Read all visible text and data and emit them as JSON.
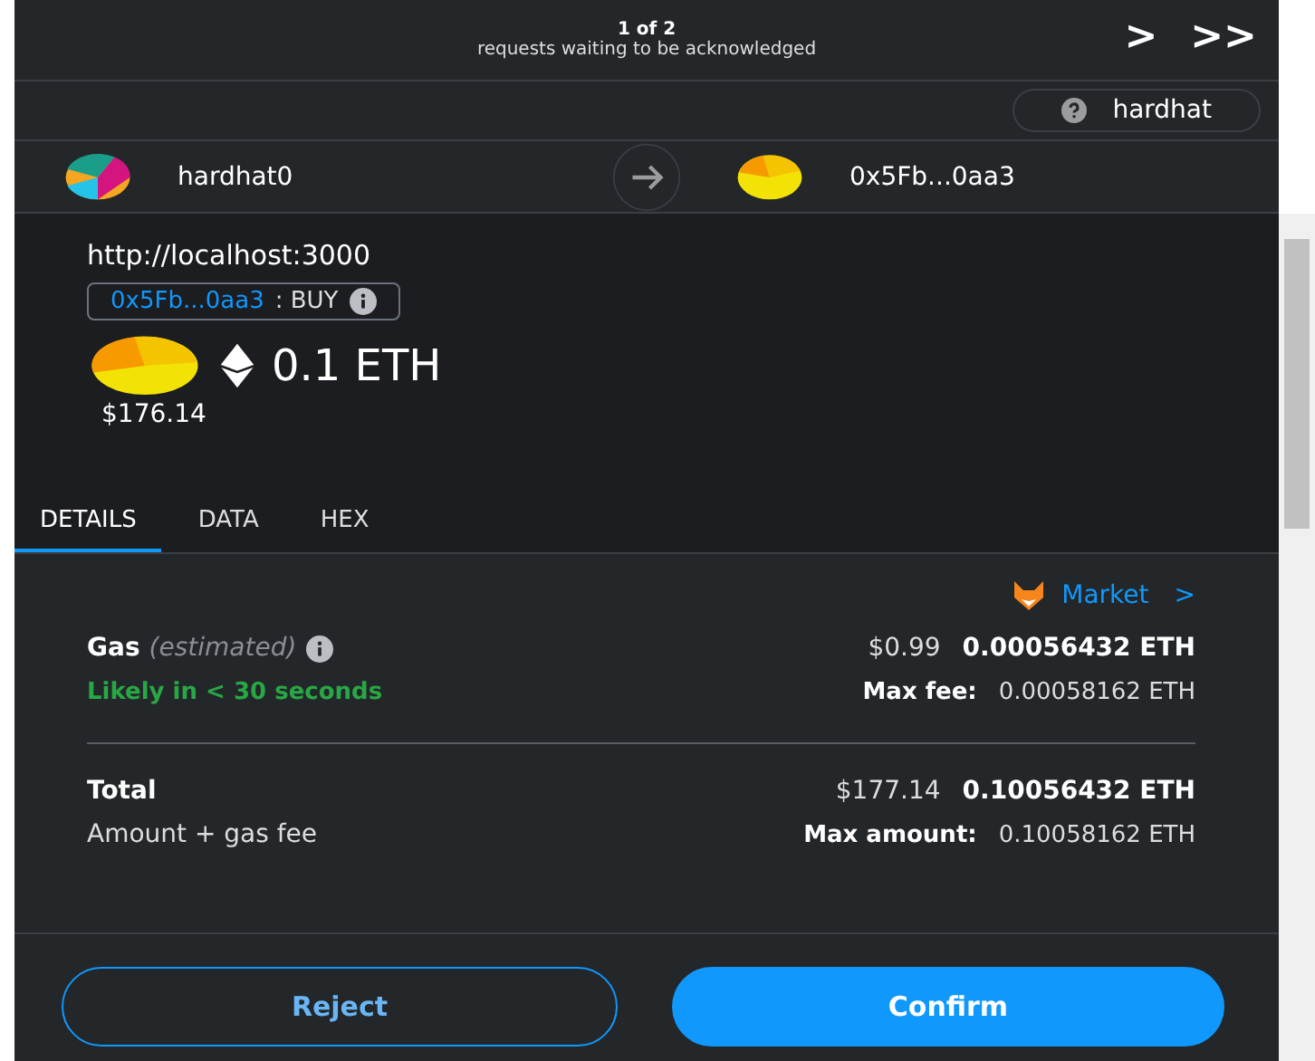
{
  "queue": {
    "counter": "1 of 2",
    "message": "requests waiting to be acknowledged",
    "next": ">",
    "last": ">>"
  },
  "network": {
    "label": "hardhat"
  },
  "from": {
    "name": "hardhat0"
  },
  "to": {
    "name": "0x5Fb...0aa3"
  },
  "summary": {
    "origin": "http://localhost:3000",
    "contract": "0x5Fb...0aa3",
    "method": ": BUY",
    "amount": "0.1 ETH",
    "fiat": "$176.14"
  },
  "tabs": [
    {
      "label": "DETAILS",
      "selected": true
    },
    {
      "label": "DATA",
      "selected": false
    },
    {
      "label": "HEX",
      "selected": false
    }
  ],
  "market": {
    "label": "Market",
    "chevron": ">"
  },
  "gas": {
    "label": "Gas",
    "note": "(estimated)",
    "fiat": "$0.99",
    "eth": "0.00056432 ETH",
    "speed": "Likely in < 30 seconds",
    "max_label": "Max fee:",
    "max_value": "0.00058162 ETH"
  },
  "total": {
    "label": "Total",
    "sub": "Amount + gas fee",
    "fiat": "$177.14",
    "eth": "0.10056432 ETH",
    "max_label": "Max amount:",
    "max_value": "0.10058162 ETH"
  },
  "buttons": [
    {
      "label": "Reject",
      "kind": "secondary"
    },
    {
      "label": "Confirm",
      "kind": "primary"
    }
  ]
}
